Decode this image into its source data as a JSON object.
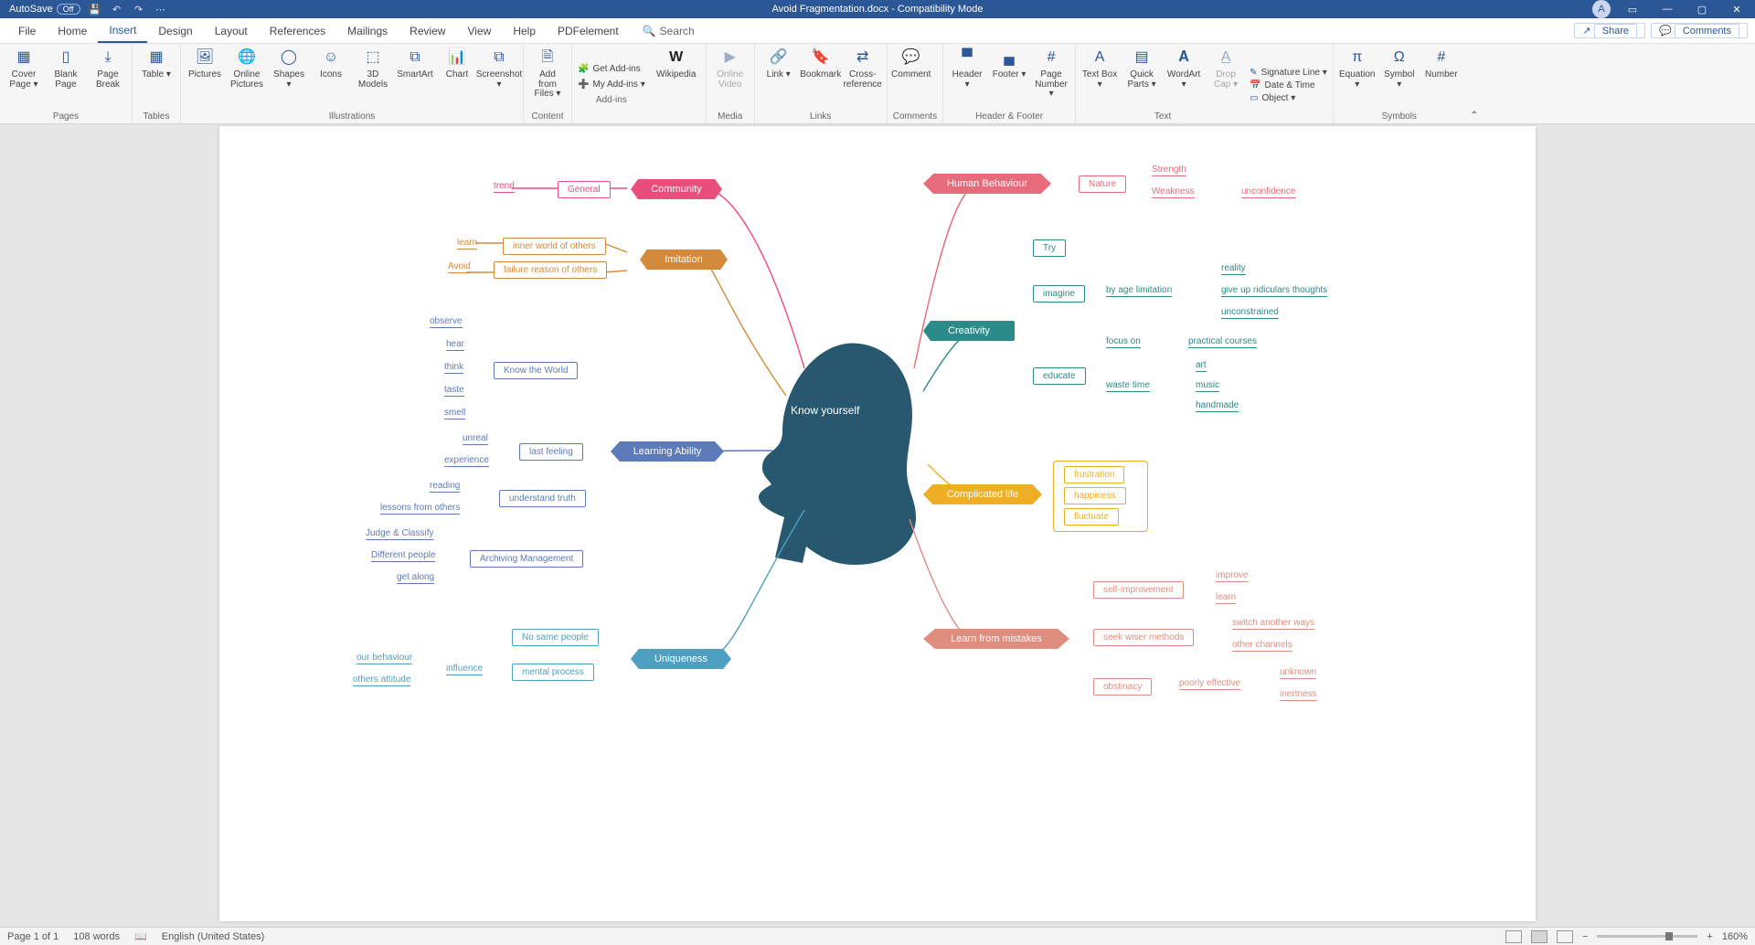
{
  "titlebar": {
    "autosave_label": "AutoSave",
    "autosave_state": "Off",
    "doc_title": "Avoid Fragmentation.docx  -  Compatibility Mode",
    "user_initial": "A"
  },
  "tabs": {
    "items": [
      "File",
      "Home",
      "Insert",
      "Design",
      "Layout",
      "References",
      "Mailings",
      "Review",
      "View",
      "Help",
      "PDFelement"
    ],
    "active_index": 2,
    "search": "Search",
    "share": "Share",
    "comments": "Comments"
  },
  "ribbon": {
    "groups": {
      "pages": {
        "title": "Pages",
        "items": [
          "Cover Page ▾",
          "Blank Page",
          "Page Break"
        ]
      },
      "tables": {
        "title": "Tables",
        "items": [
          "Table ▾"
        ]
      },
      "illustrations": {
        "title": "Illustrations",
        "items": [
          "Pictures",
          "Online Pictures",
          "Shapes ▾",
          "Icons",
          "3D Models",
          "SmartArt",
          "Chart",
          "Screenshot ▾"
        ]
      },
      "content": {
        "title": "Content",
        "items": [
          "Add from Files ▾"
        ]
      },
      "addins": {
        "title": "Add-ins",
        "get": "Get Add-ins",
        "my": "My Add-ins ▾",
        "wiki": "Wikipedia"
      },
      "media": {
        "title": "Media",
        "items": [
          "Online Video"
        ]
      },
      "links": {
        "title": "Links",
        "items": [
          "Link ▾",
          "Bookmark",
          "Cross-reference"
        ]
      },
      "comments": {
        "title": "Comments",
        "items": [
          "Comment"
        ]
      },
      "hf": {
        "title": "Header & Footer",
        "items": [
          "Header ▾",
          "Footer ▾",
          "Page Number ▾"
        ]
      },
      "text": {
        "title": "Text",
        "items": [
          "Text Box ▾",
          "Quick Parts ▾",
          "WordArt ▾",
          "Drop Cap ▾"
        ],
        "opts": [
          "Signature Line ▾",
          "Date & Time",
          "Object ▾"
        ]
      },
      "symbols": {
        "title": "Symbols",
        "items": [
          "Equation ▾",
          "Symbol ▾",
          "Number"
        ]
      }
    }
  },
  "mindmap": {
    "center": "Know yourself",
    "community": {
      "label": "Community",
      "general": "General",
      "trend": "trend"
    },
    "imitation": {
      "label": "Imitation",
      "inner": "inner world of others",
      "failure": "failure reason of others",
      "learn": "learn",
      "avoid": "Avoid"
    },
    "learning": {
      "label": "Learning Ability",
      "know_world": "Know the World",
      "senses": [
        "observe",
        "hear",
        "think",
        "taste",
        "smell"
      ],
      "last_feeling": "last feeling",
      "lf_items": [
        "unreal",
        "experience"
      ],
      "understand": "understand truth",
      "ut_items": [
        "reading",
        "lessons from others"
      ],
      "archiving": "Archiving Management",
      "am_items": [
        "Judge & Classify",
        "Different people",
        "get along"
      ]
    },
    "uniqueness": {
      "label": "Uniqueness",
      "no_same": "No same people",
      "mental": "mental process",
      "influence": "influence",
      "behaviour": "our behaviour",
      "others": "others attitude"
    },
    "human": {
      "label": "Human Behaviour",
      "nature": "Nature",
      "strength": "Strength",
      "weakness": "Weakness",
      "unconfidence": "unconfidence"
    },
    "creativity": {
      "label": "Creativity",
      "try": "Try",
      "imagine": "imagine",
      "educate": "educate",
      "by_age": "by age limitation",
      "im_items": [
        "reality",
        "give up ridiculars thoughts",
        "unconstrained"
      ],
      "focus": "focus on",
      "practical": "practical courses",
      "waste": "waste time",
      "wt_items": [
        "art",
        "music",
        "handmade"
      ]
    },
    "complicated": {
      "label": "Complicated life",
      "items": [
        "frustration",
        "happiness",
        "fluctuate"
      ]
    },
    "mistakes": {
      "label": "Learn from mistakes",
      "self_improvement": "self-improvement",
      "si_items": [
        "improve",
        "learn"
      ],
      "seek": "seek wiser methods",
      "sk_items": [
        "switch another ways",
        "other channels"
      ],
      "obstinacy": "obstinacy",
      "poorly": "poorly effective",
      "ob_items": [
        "unknown",
        "inertness"
      ]
    }
  },
  "status": {
    "page": "Page 1 of 1",
    "words": "108 words",
    "lang": "English (United States)",
    "zoom": "160%"
  }
}
